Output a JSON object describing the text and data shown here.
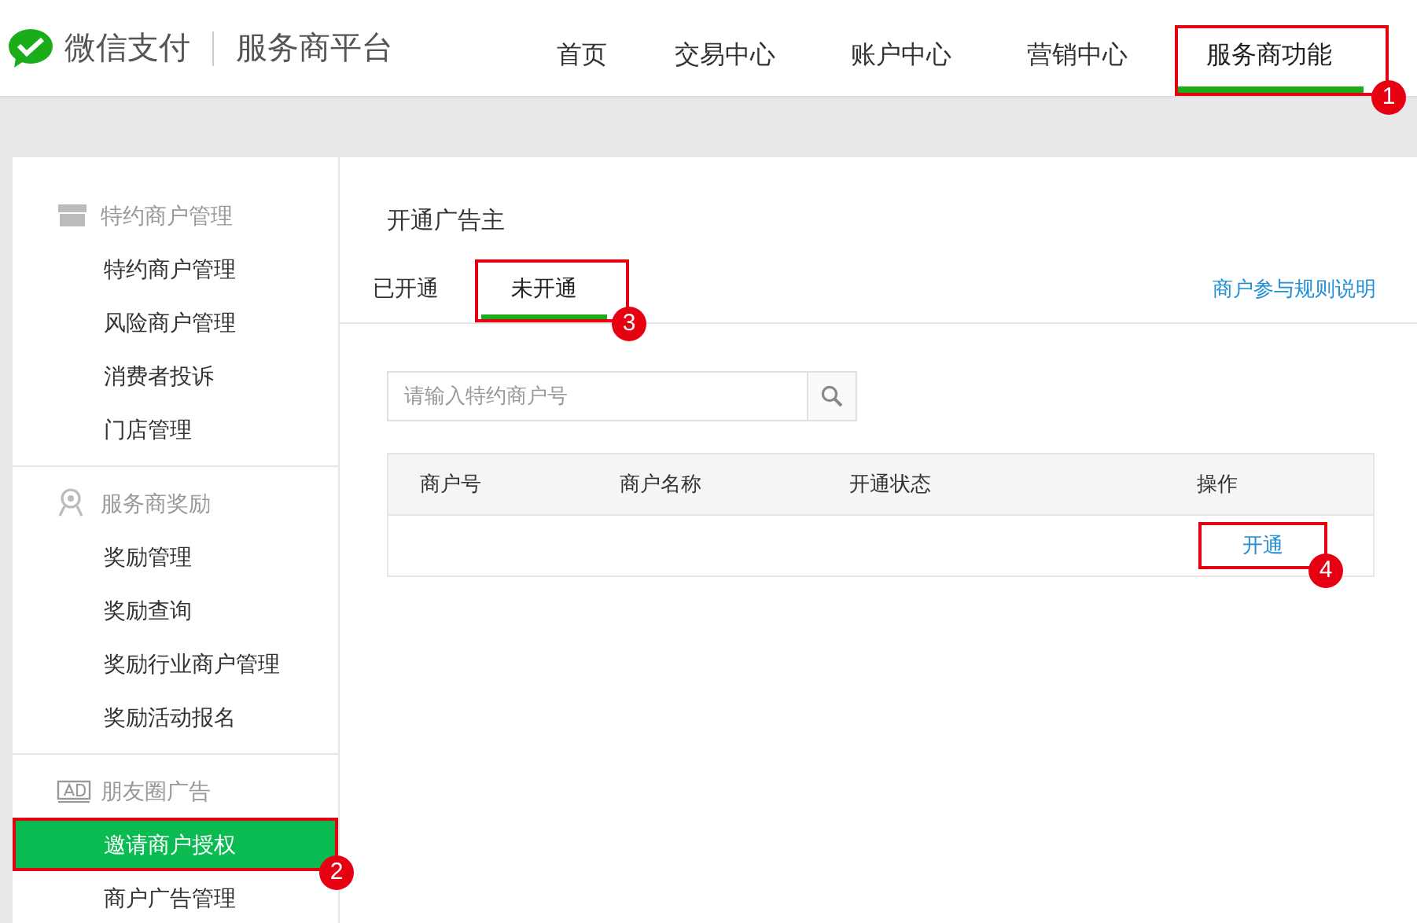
{
  "header": {
    "brand": "微信支付",
    "platform": "服务商平台",
    "nav": [
      {
        "label": "首页",
        "selected": false
      },
      {
        "label": "交易中心",
        "selected": false
      },
      {
        "label": "账户中心",
        "selected": false
      },
      {
        "label": "营销中心",
        "selected": false
      },
      {
        "label": "服务商功能",
        "selected": true,
        "callout": "1"
      }
    ]
  },
  "sidebar": {
    "groups": [
      {
        "title": "特约商户管理",
        "items": [
          {
            "label": "特约商户管理",
            "selected": false
          },
          {
            "label": "风险商户管理",
            "selected": false
          },
          {
            "label": "消费者投诉",
            "selected": false
          },
          {
            "label": "门店管理",
            "selected": false
          }
        ]
      },
      {
        "title": "服务商奖励",
        "items": [
          {
            "label": "奖励管理",
            "selected": false
          },
          {
            "label": "奖励查询",
            "selected": false
          },
          {
            "label": "奖励行业商户管理",
            "selected": false
          },
          {
            "label": "奖励活动报名",
            "selected": false
          }
        ]
      },
      {
        "title": "朋友圈广告",
        "items": [
          {
            "label": "邀请商户授权",
            "selected": true,
            "callout": "2"
          },
          {
            "label": "商户广告管理",
            "selected": false
          }
        ]
      }
    ]
  },
  "content": {
    "title": "开通广告主",
    "tabs": [
      {
        "label": "已开通",
        "selected": false
      },
      {
        "label": "未开通",
        "selected": true,
        "callout": "3"
      }
    ],
    "rules_link": "商户参与规则说明",
    "search": {
      "placeholder": "请输入特约商户号"
    },
    "table": {
      "columns": [
        "商户号",
        "商户名称",
        "开通状态",
        "操作"
      ],
      "rows": [
        {
          "action": "开通",
          "callout": "4"
        }
      ]
    }
  }
}
